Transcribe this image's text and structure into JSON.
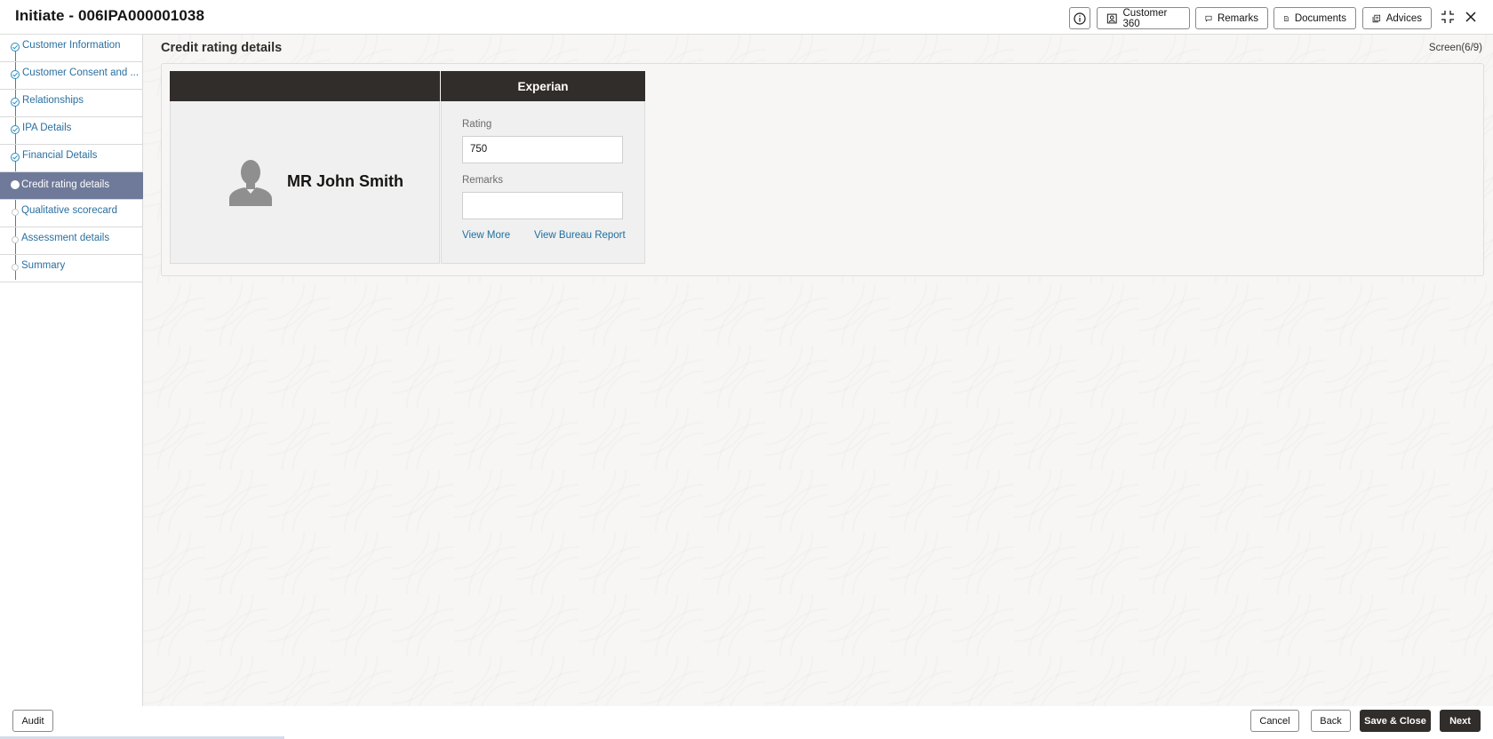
{
  "header": {
    "title": "Initiate - 006IPA000001038",
    "buttons": {
      "customer360": "Customer 360",
      "remarks": "Remarks",
      "documents": "Documents",
      "advices": "Advices"
    }
  },
  "sidebar": {
    "items": [
      {
        "label": "Customer Information",
        "state": "done"
      },
      {
        "label": "Customer Consent and ...",
        "state": "done"
      },
      {
        "label": "Relationships",
        "state": "done"
      },
      {
        "label": "IPA Details",
        "state": "done"
      },
      {
        "label": "Financial Details",
        "state": "done"
      },
      {
        "label": "Credit rating details",
        "state": "active"
      },
      {
        "label": "Qualitative scorecard",
        "state": "pending"
      },
      {
        "label": "Assessment details",
        "state": "pending"
      },
      {
        "label": "Summary",
        "state": "pending"
      }
    ]
  },
  "main": {
    "section_title": "Credit rating details",
    "screen_count": "Screen(6/9)",
    "card": {
      "bureau": "Experian",
      "customer_name": "MR John Smith",
      "rating_label": "Rating",
      "rating_value": "750",
      "remarks_label": "Remarks",
      "remarks_value": "",
      "view_more": "View More",
      "view_bureau_report": "View Bureau Report"
    }
  },
  "footer": {
    "audit": "Audit",
    "cancel": "Cancel",
    "back": "Back",
    "save_close": "Save & Close",
    "next": "Next"
  },
  "colors": {
    "active_nav": "#6f7a9a",
    "dark": "#312d2a",
    "link": "#1f6f9f",
    "step_line": "#2a8bbf"
  }
}
